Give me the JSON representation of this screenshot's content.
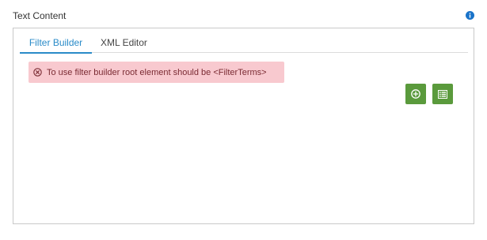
{
  "field": {
    "label": "Text Content",
    "info_icon": "info-icon"
  },
  "tabs": [
    {
      "label": "Filter Builder",
      "active": true
    },
    {
      "label": "XML Editor",
      "active": false
    }
  ],
  "alert": {
    "icon": "error-circle-icon",
    "message": "To use filter builder root element should be <FilterTerms>"
  },
  "actions": {
    "add_icon": "plus-circle-icon",
    "list_icon": "list-icon"
  },
  "colors": {
    "accent": "#2a8bc8",
    "alert_bg": "#f8c9cf",
    "alert_text": "#7a2b33",
    "button_green": "#5a9a3c",
    "info_blue": "#1a73c9"
  }
}
